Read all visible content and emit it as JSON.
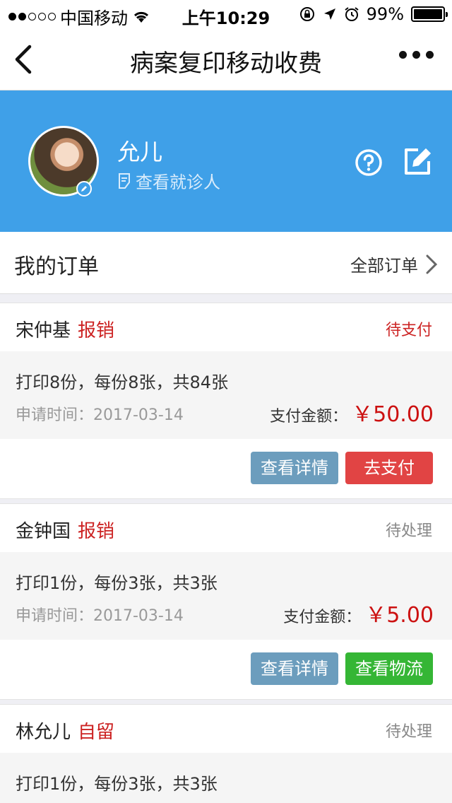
{
  "status_bar": {
    "carrier": "中国移动",
    "time": "上午10:29",
    "battery": "99%",
    "battery_level": 0.99
  },
  "nav": {
    "title": "病案复印移动收费"
  },
  "profile": {
    "name": "允儿",
    "view_patient": "查看就诊人"
  },
  "orders_header": {
    "title": "我的订单",
    "all_orders": "全部订单"
  },
  "orders": [
    {
      "patient": "宋仲基",
      "type": "报销",
      "status": "待支付",
      "desc": "打印8份，每份8张，共84张",
      "time": "申请时间：2017-03-14",
      "amount_label": "支付金额：",
      "amount": "￥50.00",
      "btn_detail": "查看详情",
      "btn_action": "去支付"
    },
    {
      "patient": "金钟国",
      "type": "报销",
      "status": "待处理",
      "desc": "打印1份，每份3张，共3张",
      "time": "申请时间：2017-03-14",
      "amount_label": "支付金额：",
      "amount": "￥5.00",
      "btn_detail": "查看详情",
      "btn_action": "查看物流"
    },
    {
      "patient": "林允儿",
      "type": "自留",
      "status": "待处理",
      "desc": "打印1份，每份3张，共3张"
    }
  ],
  "colors": {
    "banner": "#3fa0e8",
    "accent_red": "#cc2222",
    "pay_button": "#e14444",
    "detail_button": "#6c9dbd",
    "logistics_button": "#35b635"
  }
}
